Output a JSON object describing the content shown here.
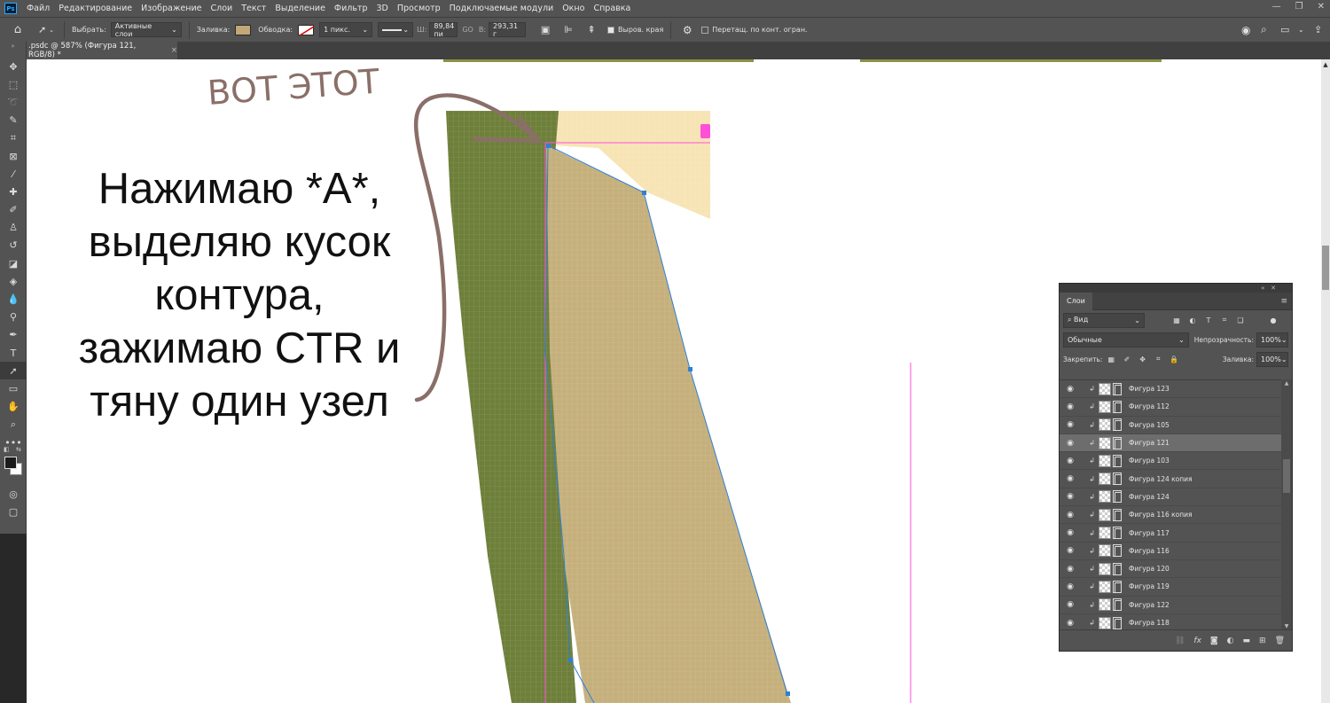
{
  "menubar": {
    "logo": "Ps",
    "items": [
      "Файл",
      "Редактирование",
      "Изображение",
      "Слои",
      "Текст",
      "Выделение",
      "Фильтр",
      "3D",
      "Просмотр",
      "Подключаемые модули",
      "Окно",
      "Справка"
    ],
    "controls": [
      "—",
      "❐",
      "✕"
    ]
  },
  "optbar": {
    "select_label": "Выбрать:",
    "select_value": "Активные слои",
    "fill_label": "Заливка:",
    "fill_color": "#c2a878",
    "stroke_label": "Обводка:",
    "stroke_width": "1 пикс.",
    "w_label": "Ш:",
    "w_value": "89,84 пи",
    "link_label": "GO",
    "h_label": "В:",
    "h_value": "293,31 г",
    "align_edges": "Выров. края",
    "constrain": "Перетащ. по конт. огран."
  },
  "tab": {
    "title": ".psdc @ 587% (Фигура 121, RGB/8) *",
    "close": "×"
  },
  "annotation": {
    "handwritten": "ВОТ ЭТОТ",
    "lines": [
      "Нажимаю *A*,",
      "выделяю кусок",
      "контура,",
      "зажимаю CTR и",
      "тяну один узел"
    ]
  },
  "layers_panel": {
    "tab": "Слои",
    "filter_value": "Вид",
    "blend_mode": "Обычные",
    "opacity_label": "Непрозрачность:",
    "opacity_value": "100%",
    "lock_label": "Закрепить:",
    "fill_label": "Заливка:",
    "fill_value": "100%",
    "layers": [
      {
        "name": "Фигура 123",
        "selected": false
      },
      {
        "name": "Фигура 112",
        "selected": false
      },
      {
        "name": "Фигура 105",
        "selected": false
      },
      {
        "name": "Фигура 121",
        "selected": true
      },
      {
        "name": "Фигура 103",
        "selected": false
      },
      {
        "name": "Фигура 124 копия",
        "selected": false
      },
      {
        "name": "Фигура 124",
        "selected": false
      },
      {
        "name": "Фигура 116 копия",
        "selected": false
      },
      {
        "name": "Фигура 117",
        "selected": false
      },
      {
        "name": "Фигура 116",
        "selected": false
      },
      {
        "name": "Фигура 120",
        "selected": false
      },
      {
        "name": "Фигура 119",
        "selected": false
      },
      {
        "name": "Фигура 122",
        "selected": false
      },
      {
        "name": "Фигура 118",
        "selected": false
      }
    ],
    "footer_fx": "fx"
  },
  "colors": {
    "green": "#6e7f3a",
    "tan": "#c5b07c",
    "light": "#f7e4b5",
    "path": "#2f7fd6",
    "guide": "#ff4fd8",
    "pen": "#8a6f68"
  }
}
